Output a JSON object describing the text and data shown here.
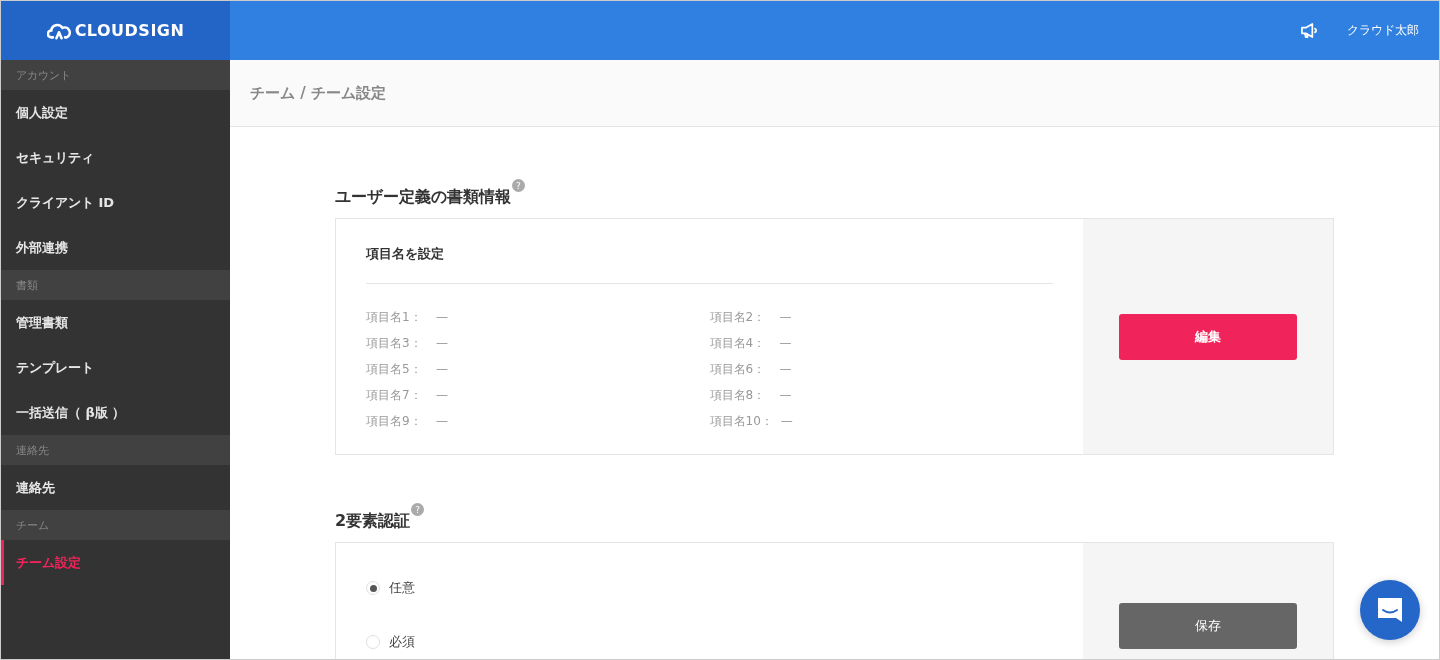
{
  "header": {
    "logo": "CLOUDSIGN",
    "user": "クラウド太郎"
  },
  "sidebar": {
    "groups": [
      {
        "heading": "アカウント",
        "items": [
          {
            "label": "個人設定",
            "selected": false
          },
          {
            "label": "セキュリティ",
            "selected": false
          },
          {
            "label": "クライアント ID",
            "selected": false
          },
          {
            "label": "外部連携",
            "selected": false
          }
        ]
      },
      {
        "heading": "書類",
        "items": [
          {
            "label": "管理書類",
            "selected": false
          },
          {
            "label": "テンプレート",
            "selected": false
          },
          {
            "label": "一括送信（ β版 ）",
            "selected": false
          }
        ]
      },
      {
        "heading": "連絡先",
        "items": [
          {
            "label": "連絡先",
            "selected": false
          }
        ]
      },
      {
        "heading": "チーム",
        "items": [
          {
            "label": "チーム設定",
            "selected": true
          }
        ]
      }
    ]
  },
  "breadcrumb": "チーム / チーム設定",
  "sections": [
    {
      "kind": "fields",
      "title": "ユーザー定義の書類情報",
      "help": "?",
      "subtitle": "項目名を設定",
      "fields": [
        {
          "label": "項目名1：",
          "value": "—"
        },
        {
          "label": "項目名2：",
          "value": "—"
        },
        {
          "label": "項目名3：",
          "value": "—"
        },
        {
          "label": "項目名4：",
          "value": "—"
        },
        {
          "label": "項目名5：",
          "value": "—"
        },
        {
          "label": "項目名6：",
          "value": "—"
        },
        {
          "label": "項目名7：",
          "value": "—"
        },
        {
          "label": "項目名8：",
          "value": "—"
        },
        {
          "label": "項目名9：",
          "value": "—"
        },
        {
          "label": "項目名10：",
          "value": "—"
        }
      ],
      "button": {
        "label": "編集",
        "kind": "primary"
      }
    },
    {
      "kind": "radios",
      "title": "2要素認証",
      "help": "?",
      "options": [
        {
          "label": "任意",
          "selected": true
        },
        {
          "label": "必須",
          "selected": false
        }
      ],
      "button": {
        "label": "保存",
        "kind": "secondary"
      }
    }
  ]
}
